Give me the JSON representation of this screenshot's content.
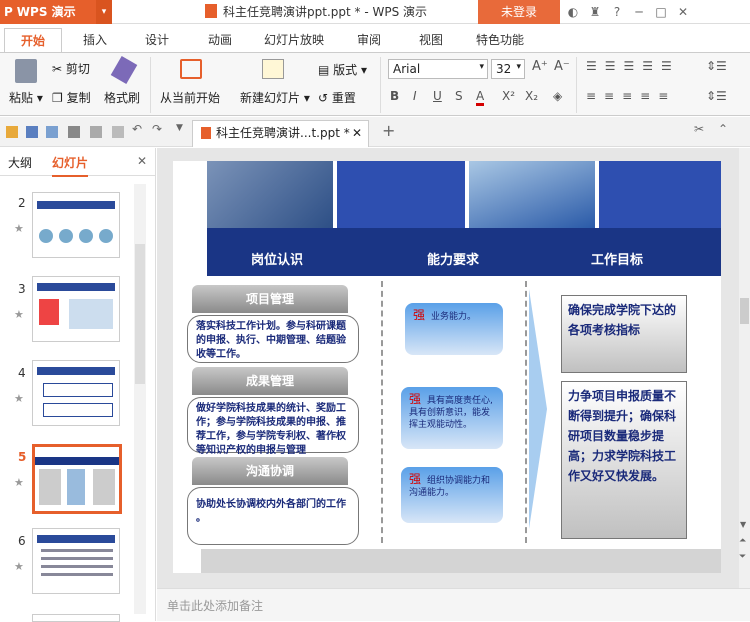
{
  "app": {
    "logo_text": "WPS 演示",
    "document_title": "科主任竞聘演讲ppt.ppt * - WPS 演示",
    "login_label": "未登录"
  },
  "menu_tabs": [
    "开始",
    "插入",
    "设计",
    "动画",
    "幻灯片放映",
    "审阅",
    "视图",
    "特色功能"
  ],
  "ribbon": {
    "paste": "粘贴",
    "cut": "剪切",
    "copy": "复制",
    "format_painter": "格式刷",
    "from_current": "从当前开始",
    "new_slide": "新建幻灯片",
    "layout": "版式",
    "reset": "重置",
    "font_name": "Arial",
    "font_size": "32"
  },
  "document_tab": {
    "label": "科主任竞聘演讲...t.ppt *"
  },
  "left_pane": {
    "tab_outline": "大纲",
    "tab_slides": "幻灯片",
    "slide_numbers": [
      "2",
      "3",
      "4",
      "5",
      "6"
    ],
    "selected": "5"
  },
  "slide": {
    "headers": [
      "岗位认识",
      "能力要求",
      "工作目标"
    ],
    "col1": [
      {
        "title": "项目管理",
        "body": "落实科技工作计划。参与科研课题的申报、执行、中期管理、结题验收等工作。"
      },
      {
        "title": "成果管理",
        "body": "做好学院科技成果的统计、奖励工作；参与学院科技成果的申报、推荐工作，参与学院专利权、著作权等知识产权的申报与管理"
      },
      {
        "title": "沟通协调",
        "body": "协助处长协调校内外各部门的工作 。"
      }
    ],
    "col2": [
      {
        "mark": "强",
        "text": "业务能力。"
      },
      {
        "mark": "强",
        "text": "具有高度责任心,具有创新意识，能发挥主观能动性。"
      },
      {
        "mark": "强",
        "text": "组织协调能力和沟通能力。"
      }
    ],
    "col3": [
      "确保完成学院下达的各项考核指标",
      "力争项目申报质量不断得到提升；确保科研项目数量稳步提高；力求学院科技工作又好又快发展。"
    ]
  },
  "notes_placeholder": "单击此处添加备注",
  "colors": {
    "accent": "#e65f2b",
    "slide_band": "#1a3585"
  }
}
